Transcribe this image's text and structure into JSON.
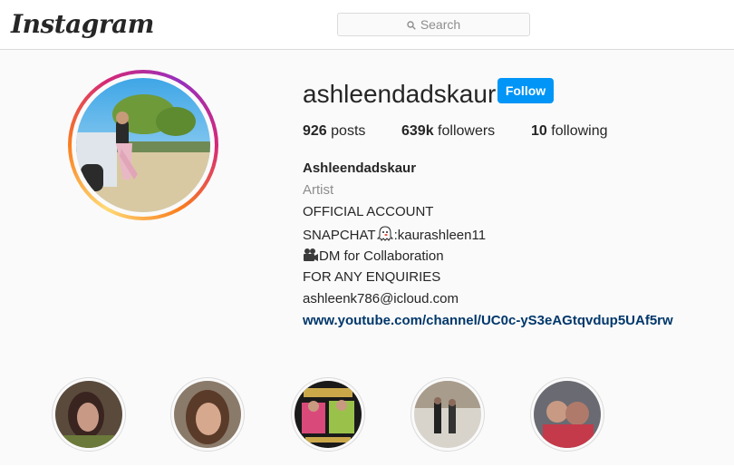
{
  "header": {
    "logo_text": "Instagram",
    "search_placeholder": "Search"
  },
  "profile": {
    "username": "ashleendadskaur",
    "follow_label": "Follow",
    "stats": {
      "posts_count": "926",
      "posts_label": "posts",
      "followers_count": "639k",
      "followers_label": "followers",
      "following_count": "10",
      "following_label": "following"
    },
    "bio": {
      "name": "Ashleendadskaur",
      "category": "Artist",
      "line1": "OFFICIAL ACCOUNT",
      "line2_prefix": "SNAPCHAT",
      "line2_suffix": ":kaurashleen11",
      "line3_text": "DM for Collaboration",
      "line4": "FOR ANY ENQUIRIES",
      "line5": "ashleenk786@icloud.com",
      "link": "www.youtube.com/channel/UC0c-yS3eAGtqvdup5UAf5rw"
    }
  },
  "colors": {
    "follow_button": "#0095f6",
    "link": "#00376b",
    "muted": "#8e8e8e"
  }
}
